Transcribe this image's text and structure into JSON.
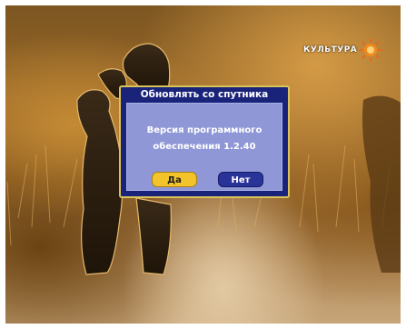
{
  "channel_logo": {
    "text": "КУЛЬТУРА",
    "icon": "sun-logo-icon",
    "color": "#e8681a"
  },
  "dialog": {
    "title": "Обновлять со спутника",
    "message_line1": "Версия программного",
    "message_line2": "обеспечения 1.2.40",
    "yes_label": "Да",
    "no_label": "Нет"
  },
  "colors": {
    "dialog_frame": "#1a237a",
    "dialog_border": "#d9c25a",
    "dialog_body": "#8f97d6",
    "yes_button": "#f2c42a",
    "no_button": "#2a3398"
  }
}
